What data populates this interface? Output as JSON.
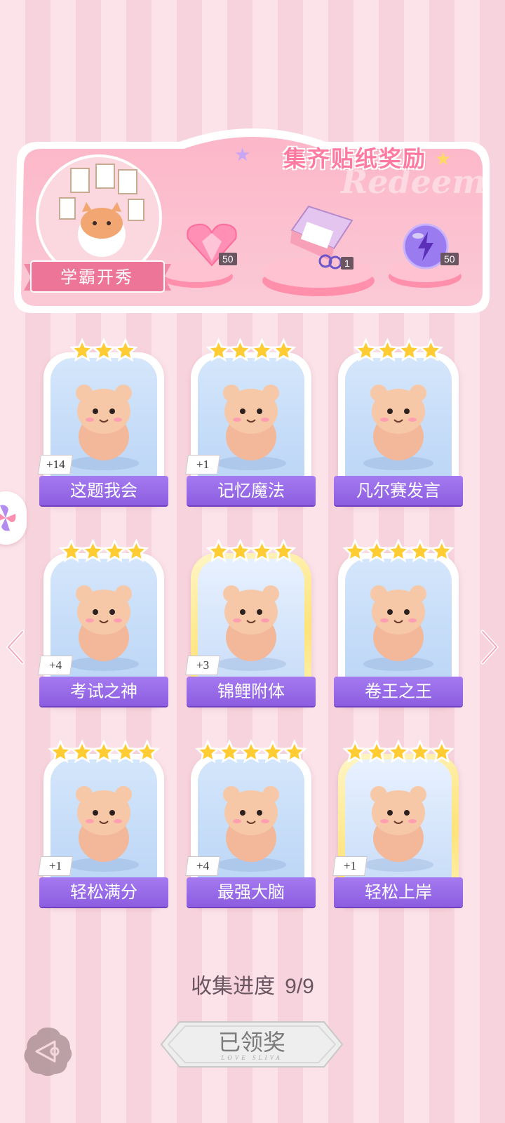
{
  "banner": {
    "title": "集齐贴纸奖励",
    "watermark": "Redeem",
    "event_label": "学霸开秀",
    "rewards": [
      {
        "icon": "pink-heart-diamond-icon",
        "count": "50"
      },
      {
        "icon": "gift-box-icon",
        "count": "1"
      },
      {
        "icon": "purple-lightning-orb-icon",
        "count": "50"
      }
    ]
  },
  "cards": [
    {
      "name": "这题我会",
      "count": "+14",
      "stars": 3,
      "gold": false,
      "icon": "bear-at-desk-icon"
    },
    {
      "name": "记忆魔法",
      "count": "+1",
      "stars": 4,
      "gold": false,
      "icon": "wizard-otter-icon"
    },
    {
      "name": "凡尔赛发言",
      "count": "",
      "stars": 4,
      "gold": false,
      "icon": "lion-microphone-icon"
    },
    {
      "name": "考试之神",
      "count": "+4",
      "stars": 4,
      "gold": false,
      "icon": "angel-cat-icon"
    },
    {
      "name": "锦鲤附体",
      "count": "+3",
      "stars": 4,
      "gold": true,
      "icon": "bear-koi-fish-icon"
    },
    {
      "name": "卷王之王",
      "count": "",
      "stars": 5,
      "gold": false,
      "icon": "cat-studying-icon"
    },
    {
      "name": "轻松满分",
      "count": "+1",
      "stars": 5,
      "gold": false,
      "icon": "puppy-full-score-icon"
    },
    {
      "name": "最强大脑",
      "count": "+4",
      "stars": 5,
      "gold": false,
      "icon": "cat-papers-icon"
    },
    {
      "name": "轻松上岸",
      "count": "+1",
      "stars": 5,
      "gold": true,
      "icon": "squirrel-graduate-icon"
    }
  ],
  "progress": {
    "label": "收集进度",
    "value": "9/9"
  },
  "claim_button": {
    "label": "已领奖",
    "sub": "LOVE SLIVA"
  },
  "colors": {
    "accent_pink": "#ff7aa0",
    "label_purple": "#9a6be8",
    "star_gold": "#ffcc33"
  }
}
